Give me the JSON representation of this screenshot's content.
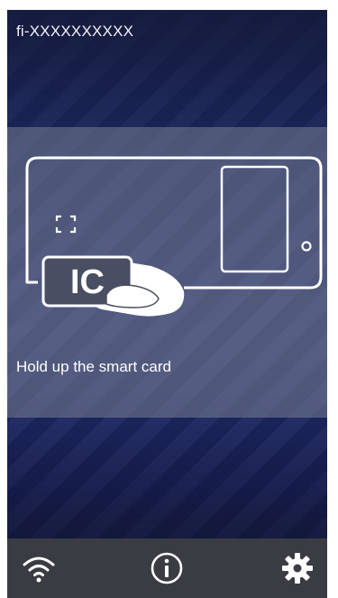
{
  "header": {
    "title": "fi-XXXXXXXXXX"
  },
  "main": {
    "card_chip_label": "IC",
    "instruction": "Hold up the smart card"
  },
  "toolbar": {
    "icons": [
      "wifi-icon",
      "info-icon",
      "gear-icon"
    ]
  },
  "colors": {
    "background": "#1c2a63",
    "panel": "#7b7f92",
    "bottom_bar": "#3a3c44",
    "icon": "#ffffff"
  }
}
